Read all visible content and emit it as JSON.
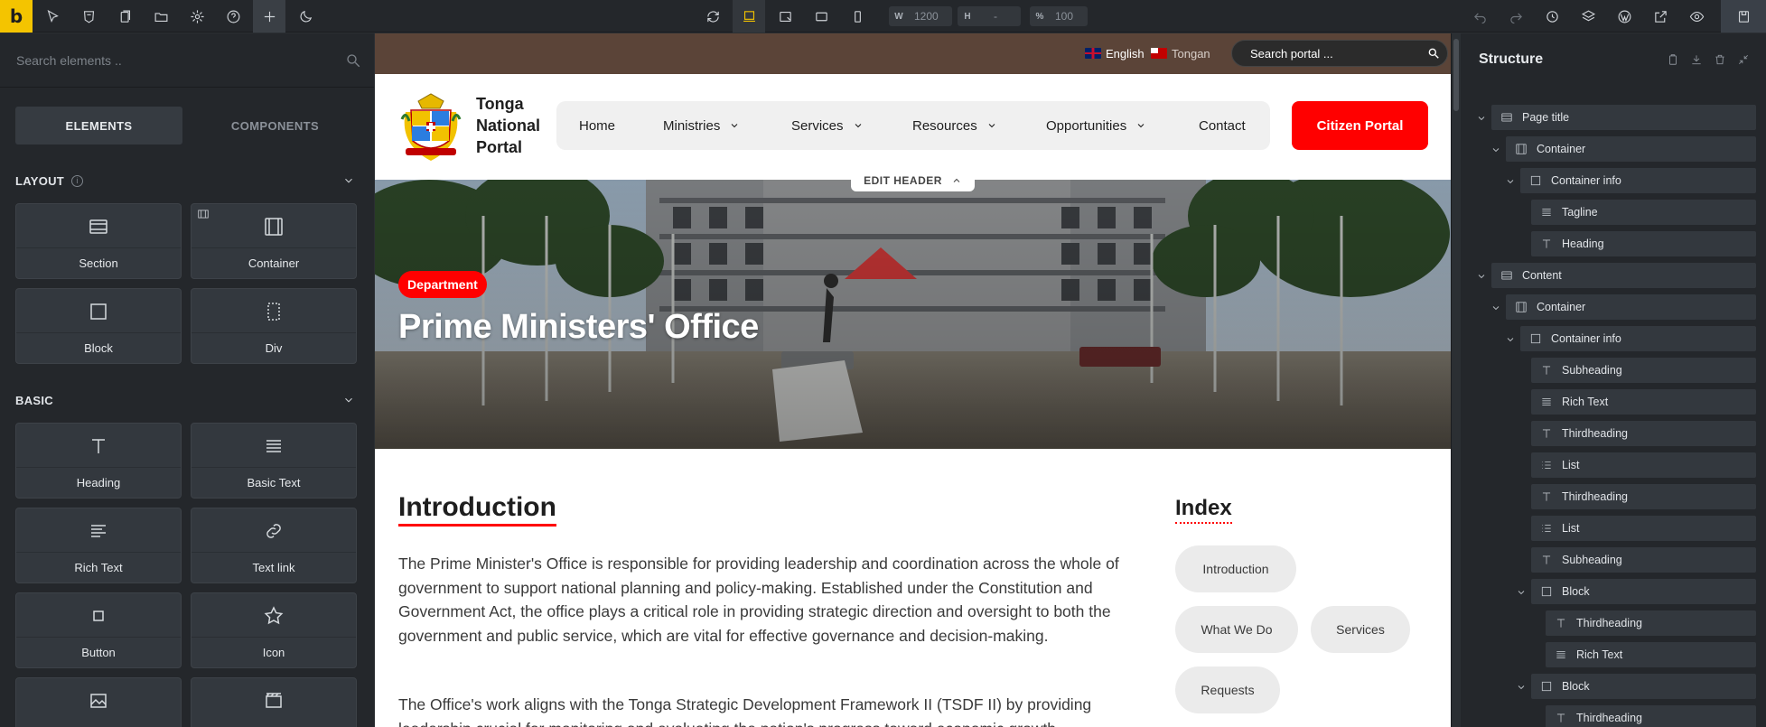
{
  "toolbar": {
    "logo_letter": "b",
    "width_key": "W",
    "width_value": "1200",
    "height_key": "H",
    "height_value": "-",
    "zoom_key": "%",
    "zoom_value": "100"
  },
  "left_panel": {
    "search_placeholder": "Search elements ..",
    "tabs": [
      "ELEMENTS",
      "COMPONENTS"
    ],
    "layout_title": "LAYOUT",
    "layout_info": "i",
    "layout_items": [
      "Section",
      "Container",
      "Block",
      "Div"
    ],
    "basic_title": "BASIC",
    "basic_items": [
      "Heading",
      "Basic Text",
      "Rich Text",
      "Text link",
      "Button",
      "Icon"
    ]
  },
  "canvas": {
    "lang_english": "English",
    "lang_tongan": "Tongan",
    "search_placeholder": "Search portal ...",
    "site_name": "Tonga National Portal",
    "nav": [
      "Home",
      "Ministries",
      "Services",
      "Resources",
      "Opportunities",
      "Contact"
    ],
    "cta": "Citizen Portal",
    "edit_header": "EDIT HEADER",
    "hero_badge": "Department",
    "hero_title": "Prime Ministers' Office",
    "intro_heading": "Introduction",
    "para1": "The Prime Minister's Office is responsible for providing leadership and coordination across the whole of government to support national planning and policy-making. Established under the Constitution and Government Act, the office plays a critical role in providing strategic direction and oversight to both the government and public service, which are vital for effective governance and decision-making.",
    "para2": "The Office's work aligns with the Tonga Strategic Development Framework II (TSDF II) by providing leadership crucial for monitoring and evaluating the nation's progress toward economic growth,",
    "index_heading": "Index",
    "index_items": [
      "Introduction",
      "What We Do",
      "Services",
      "Requests"
    ]
  },
  "structure": {
    "title": "Structure",
    "rows": [
      {
        "label": "Page title",
        "icon": "section-icon"
      },
      {
        "label": "Container",
        "icon": "container-icon"
      },
      {
        "label": "Container info",
        "icon": "block-icon"
      },
      {
        "label": "Tagline",
        "icon": "text-lines-icon"
      },
      {
        "label": "Heading",
        "icon": "heading-icon"
      },
      {
        "label": "Content",
        "icon": "section-icon"
      },
      {
        "label": "Container",
        "icon": "container-icon"
      },
      {
        "label": "Container info",
        "icon": "block-icon"
      },
      {
        "label": "Subheading",
        "icon": "heading-icon"
      },
      {
        "label": "Rich Text",
        "icon": "text-lines-icon"
      },
      {
        "label": "Thirdheading",
        "icon": "heading-icon"
      },
      {
        "label": "List",
        "icon": "list-icon"
      },
      {
        "label": "Thirdheading",
        "icon": "heading-icon"
      },
      {
        "label": "List",
        "icon": "list-icon"
      },
      {
        "label": "Subheading",
        "icon": "heading-icon"
      },
      {
        "label": "Block",
        "icon": "block-icon"
      },
      {
        "label": "Thirdheading",
        "icon": "heading-icon"
      },
      {
        "label": "Rich Text",
        "icon": "text-lines-icon"
      },
      {
        "label": "Block",
        "icon": "block-icon"
      },
      {
        "label": "Thirdheading",
        "icon": "heading-icon"
      }
    ]
  },
  "colors": {
    "accent_yellow": "#f4c400",
    "brand_red": "#ff0000",
    "topstrip_brown": "#5b4438"
  }
}
